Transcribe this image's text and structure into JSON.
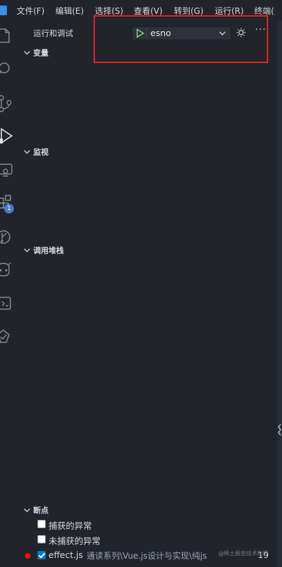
{
  "menubar": {
    "items": [
      "文件(F)",
      "编辑(E)",
      "选择(S)",
      "查看(V)",
      "转到(G)",
      "运行(R)",
      "终端("
    ]
  },
  "activity_bar": {
    "icons": [
      "explorer-icon",
      "search-icon",
      "source-control-icon",
      "run-debug-icon",
      "remote-explorer-icon",
      "extensions-icon",
      "git-graph-icon",
      "copilot-icon",
      "remote-icon",
      "testing-icon"
    ],
    "extensions_badge": "1"
  },
  "sidebar": {
    "title": "运行和调试",
    "launch_config": "esno",
    "sections": {
      "variables": "变量",
      "watch": "监视",
      "call_stack": "调用堆栈",
      "breakpoints": "断点"
    },
    "breakpoints": {
      "caught": {
        "label": "捕获的异常",
        "checked": false
      },
      "uncaught": {
        "label": "未捕获的异常",
        "checked": false
      },
      "file": {
        "label": "effect.js",
        "path": "通读系列\\Vue.js设计与实现\\纯js",
        "checked": true,
        "line": "19"
      }
    }
  },
  "watermark": "@稀土掘金技术社区",
  "colors": {
    "accent": "#007acc",
    "highlight": "#e3221e",
    "breakpoint": "#e51400",
    "play": "#89d185"
  }
}
